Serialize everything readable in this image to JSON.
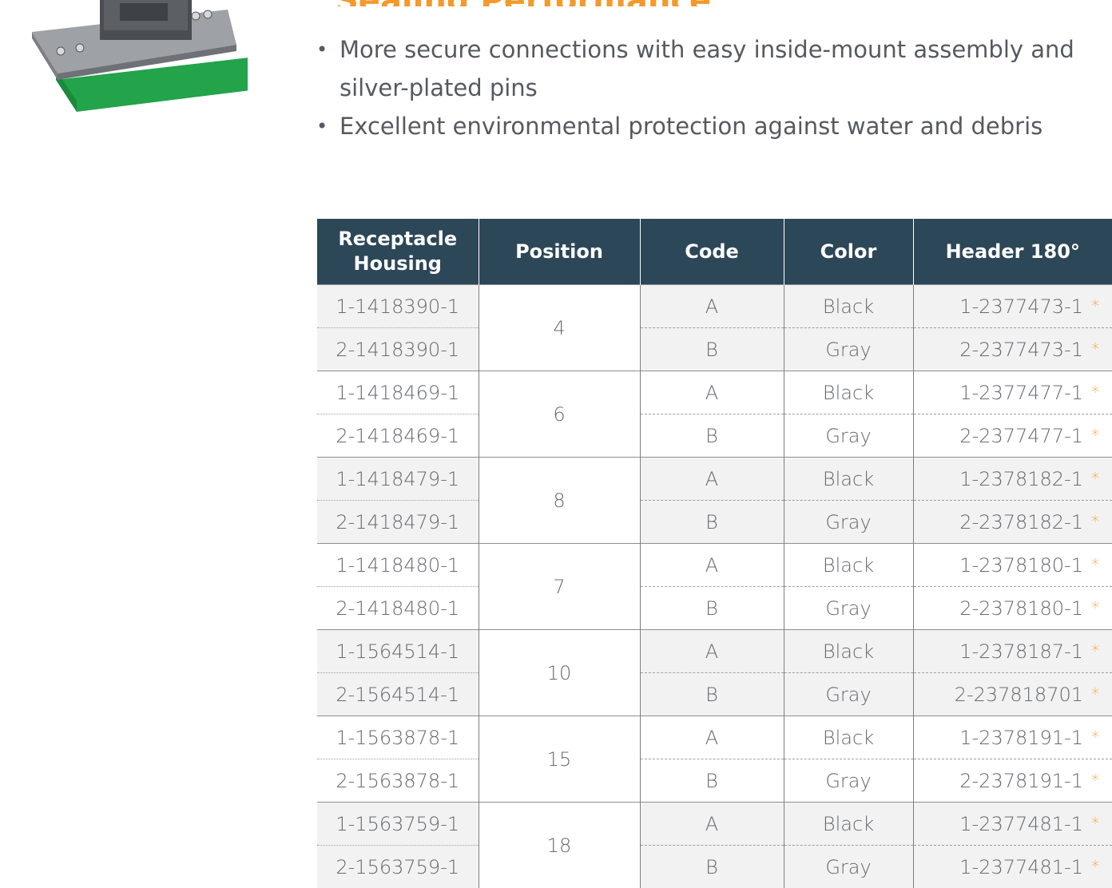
{
  "page": {
    "title_fragment": "Sealing Performance",
    "bullets": [
      "More secure connections with easy inside-mount assembly and silver-plated pins",
      "Excellent environmental protection against water and debris"
    ]
  },
  "table": {
    "headers": {
      "receptacle": "Receptacle Housing",
      "position": "Position",
      "code": "Code",
      "color": "Color",
      "header": "Header 180°"
    },
    "groups": [
      {
        "position": "4",
        "rows": [
          {
            "receptacle": "1-1418390-1",
            "code": "A",
            "color": "Black",
            "header": "1-2377473-1"
          },
          {
            "receptacle": "2-1418390-1",
            "code": "B",
            "color": "Gray",
            "header": "2-2377473-1"
          }
        ]
      },
      {
        "position": "6",
        "rows": [
          {
            "receptacle": "1-1418469-1",
            "code": "A",
            "color": "Black",
            "header": "1-2377477-1"
          },
          {
            "receptacle": "2-1418469-1",
            "code": "B",
            "color": "Gray",
            "header": "2-2377477-1"
          }
        ]
      },
      {
        "position": "8",
        "rows": [
          {
            "receptacle": "1-1418479-1",
            "code": "A",
            "color": "Black",
            "header": "1-2378182-1"
          },
          {
            "receptacle": "2-1418479-1",
            "code": "B",
            "color": "Gray",
            "header": "2-2378182-1"
          }
        ]
      },
      {
        "position": "7",
        "rows": [
          {
            "receptacle": "1-1418480-1",
            "code": "A",
            "color": "Black",
            "header": "1-2378180-1"
          },
          {
            "receptacle": "2-1418480-1",
            "code": "B",
            "color": "Gray",
            "header": "2-2378180-1"
          }
        ]
      },
      {
        "position": "10",
        "rows": [
          {
            "receptacle": "1-1564514-1",
            "code": "A",
            "color": "Black",
            "header": "1-2378187-1"
          },
          {
            "receptacle": "2-1564514-1",
            "code": "B",
            "color": "Gray",
            "header": "2-237818701"
          }
        ]
      },
      {
        "position": "15",
        "rows": [
          {
            "receptacle": "1-1563878-1",
            "code": "A",
            "color": "Black",
            "header": "1-2378191-1"
          },
          {
            "receptacle": "2-1563878-1",
            "code": "B",
            "color": "Gray",
            "header": "2-2378191-1"
          }
        ]
      },
      {
        "position": "18",
        "rows": [
          {
            "receptacle": "1-1563759-1",
            "code": "A",
            "color": "Black",
            "header": "1-2377481-1"
          },
          {
            "receptacle": "2-1563759-1",
            "code": "B",
            "color": "Gray",
            "header": "1-2377481-1"
          }
        ]
      }
    ],
    "marker": "*"
  },
  "colors": {
    "accent": "#f39a2b",
    "header_bg": "#2c4757",
    "text": "#555a60",
    "row_shade": "#f2f2f2"
  }
}
